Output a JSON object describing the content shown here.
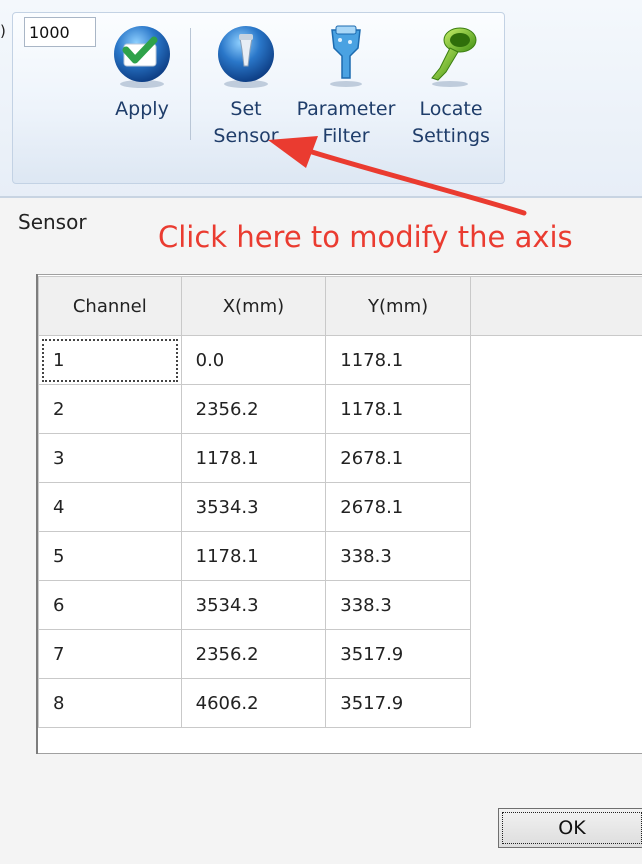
{
  "ribbon": {
    "prefix_text": ")",
    "value_input": "1000",
    "buttons": [
      {
        "label_line1": "Apply",
        "label_line2": "",
        "icon": "check-icon"
      },
      {
        "label_line1": "Set",
        "label_line2": "Sensor",
        "icon": "sensor-probe-icon"
      },
      {
        "label_line1": "Parameter",
        "label_line2": "Filter",
        "icon": "filter-icon"
      },
      {
        "label_line1": "Locate",
        "label_line2": "Settings",
        "icon": "funnel-icon"
      }
    ]
  },
  "annotation": {
    "text": "Click here to modify the axis",
    "color": "#ea3b30"
  },
  "dialog": {
    "title": "Sensor",
    "table": {
      "headers": [
        "Channel",
        "X(mm)",
        "Y(mm)"
      ],
      "rows": [
        [
          "1",
          "0.0",
          "1178.1"
        ],
        [
          "2",
          "2356.2",
          "1178.1"
        ],
        [
          "3",
          "1178.1",
          "2678.1"
        ],
        [
          "4",
          "3534.3",
          "2678.1"
        ],
        [
          "5",
          "1178.1",
          "338.3"
        ],
        [
          "6",
          "3534.3",
          "338.3"
        ],
        [
          "7",
          "2356.2",
          "3517.9"
        ],
        [
          "8",
          "4606.2",
          "3517.9"
        ]
      ]
    },
    "ok_label": "OK"
  },
  "colors": {
    "ribbon_label": "#1f3d6a",
    "annotation": "#ea3b30"
  }
}
